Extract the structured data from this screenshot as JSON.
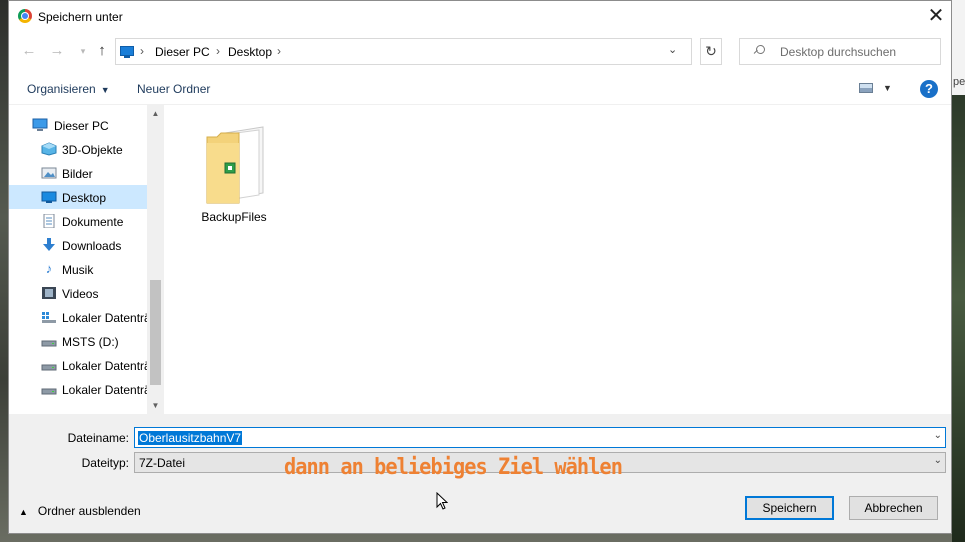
{
  "window": {
    "title": "Speichern unter"
  },
  "background": {
    "edge_text": "pel"
  },
  "navigation": {
    "breadcrumbs": [
      "Dieser PC",
      "Desktop"
    ],
    "search_placeholder": "Desktop durchsuchen"
  },
  "toolbar": {
    "organize_label": "Organisieren",
    "new_folder_label": "Neuer Ordner",
    "help_label": "?"
  },
  "sidebar": {
    "items": [
      {
        "label": "Dieser PC",
        "icon": "computer-icon",
        "level": 0,
        "selected": false
      },
      {
        "label": "3D-Objekte",
        "icon": "cube-icon",
        "level": 1,
        "selected": false
      },
      {
        "label": "Bilder",
        "icon": "pictures-icon",
        "level": 1,
        "selected": false
      },
      {
        "label": "Desktop",
        "icon": "desktop-icon",
        "level": 1,
        "selected": true
      },
      {
        "label": "Dokumente",
        "icon": "document-icon",
        "level": 1,
        "selected": false
      },
      {
        "label": "Downloads",
        "icon": "download-arrow-icon",
        "level": 1,
        "selected": false
      },
      {
        "label": "Musik",
        "icon": "music-note-icon",
        "level": 1,
        "selected": false
      },
      {
        "label": "Videos",
        "icon": "film-icon",
        "level": 1,
        "selected": false
      },
      {
        "label": "Lokaler Datenträ",
        "icon": "windows-drive-icon",
        "level": 1,
        "selected": false
      },
      {
        "label": "MSTS (D:)",
        "icon": "drive-icon",
        "level": 1,
        "selected": false
      },
      {
        "label": "Lokaler Datenträ",
        "icon": "drive-icon",
        "level": 1,
        "selected": false
      },
      {
        "label": "Lokaler Datenträ",
        "icon": "drive-icon",
        "level": 1,
        "selected": false
      }
    ]
  },
  "content": {
    "files": [
      {
        "name": "BackupFiles",
        "icon": "folder-icon"
      }
    ]
  },
  "form": {
    "filename_label": "Dateiname:",
    "filename_value": "OberlausitzbahnV7",
    "filetype_label": "Dateityp:",
    "filetype_value": "7Z-Datei"
  },
  "annotation": {
    "text": "dann an beliebiges Ziel wählen",
    "color": "#ee8133"
  },
  "footer": {
    "hide_folders_label": "Ordner ausblenden",
    "save_label": "Speichern",
    "cancel_label": "Abbrechen"
  },
  "colors": {
    "accent": "#0078d7",
    "selection": "#cce8ff",
    "link_text": "#1e3a5c"
  }
}
